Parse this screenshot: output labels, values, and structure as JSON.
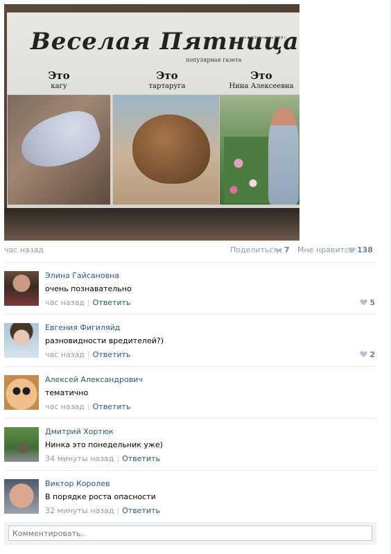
{
  "post": {
    "photo": {
      "newspaper_title": "Веселая Пятница",
      "newspaper_subtitle": "популярная газета",
      "issue_line": "№ 4 (15) 2 марта 2018 г.",
      "captions": [
        {
          "big": "Это",
          "small": "кагу"
        },
        {
          "big": "Это",
          "small": "тартаруга"
        },
        {
          "big": "Это",
          "small": "Нина Алексеевна"
        }
      ]
    },
    "time": "час назад",
    "share_label": "Поделиться",
    "share_count": "7",
    "like_label": "Мне нравится",
    "like_count": "138"
  },
  "comments": [
    {
      "author": "Элина Гайсановна",
      "text": "очень познавательно",
      "time": "час назад",
      "reply": "Ответить",
      "likes": "5"
    },
    {
      "author": "Евгения Фигиляйд",
      "text": "разновидности вредителей?)",
      "time": "час назад",
      "reply": "Ответить",
      "likes": "2"
    },
    {
      "author": "Алексей Александрович",
      "text": "тематично",
      "time": "час назад",
      "reply": "Ответить",
      "likes": ""
    },
    {
      "author": "Дмитрий Хортюк",
      "text": "Нинка это понедельник уже)",
      "time": "34 минуты назад",
      "reply": "Ответить",
      "likes": ""
    },
    {
      "author": "Виктор Королев",
      "text": "В порядке роста опасности",
      "time": "32 минуты назад",
      "reply": "Ответить",
      "likes": ""
    }
  ],
  "comment_box": {
    "placeholder": "Комментировать.."
  },
  "colors": {
    "link": "#2b587a",
    "muted": "#999999",
    "like": "#6a82a0",
    "divider": "#e7eaed"
  },
  "icons": {
    "share": "megaphone-icon",
    "like": "heart-icon"
  }
}
